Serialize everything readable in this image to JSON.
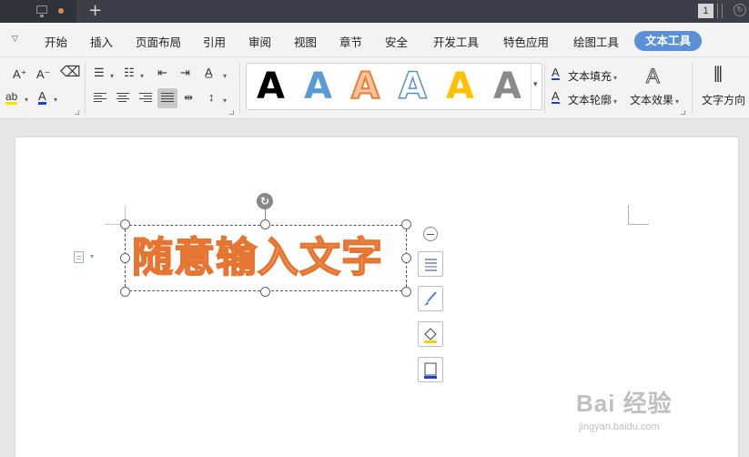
{
  "titlebar": {
    "new_tab_glyph": "+",
    "window_count": "1"
  },
  "menu": {
    "items": [
      "开始",
      "插入",
      "页面布局",
      "引用",
      "审阅",
      "视图",
      "章节",
      "安全",
      "开发工具",
      "特色应用",
      "绘图工具"
    ],
    "active": "文本工具"
  },
  "ribbon": {
    "gallery_glyph": "A",
    "text_fill_label": "文本填充",
    "text_outline_label": "文本轮廓",
    "text_effect_label": "文本效果",
    "text_direction_label": "文字方向",
    "font_grow": "A⁺",
    "font_shrink": "A⁻",
    "font_color_glyph": "A",
    "highlight_glyph": "ab"
  },
  "document": {
    "art_text": "随意输入文字"
  },
  "watermark": {
    "main": "Bai 经验",
    "sub": "jingyan.baidu.com"
  },
  "colors": {
    "accent": "#5b8fd8",
    "art_outline": "#e67532",
    "art_fill": "#f0b080"
  }
}
